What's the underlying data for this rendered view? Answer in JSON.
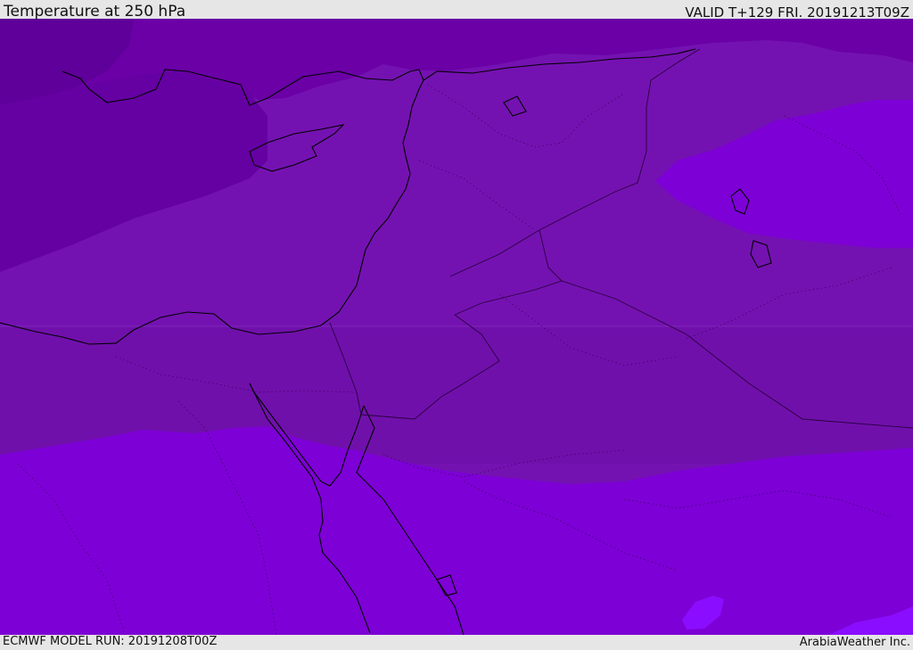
{
  "header": {
    "title": "Temperature at 250 hPa",
    "valid_time": "VALID T+129 FRI. 20191213T09Z"
  },
  "footer": {
    "model_run": "ECMWF MODEL RUN: 20191208T00Z",
    "credit": "ArabiaWeather Inc."
  },
  "colors": {
    "band_coldest": "#5e0099",
    "band_cold": "#6a00a6",
    "band_mid_upper": "#7412b1",
    "band_mid_lower": "#7010ab",
    "band_warm": "#7d00d6",
    "band_warmest": "#8a0dff",
    "coastline": "#000000",
    "border": "#2a0040"
  }
}
